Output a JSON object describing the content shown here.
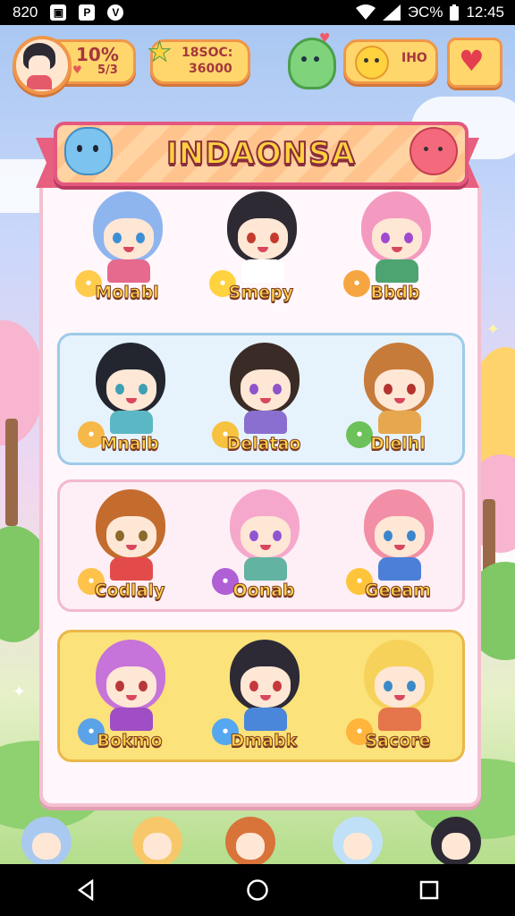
{
  "status_bar": {
    "left_text": "820",
    "icons": [
      "gallery-icon",
      "p-app-icon",
      "v-app-icon"
    ],
    "battery_text": "ЭС%",
    "time": "12:45"
  },
  "hud": {
    "level": "10%",
    "sub_value": "5/3",
    "star_value": "18SOC:",
    "star_sub": "36000",
    "coin_value": "IHO"
  },
  "banner": {
    "title": "INDAONSA"
  },
  "rows": [
    {
      "bg": "#ffffff",
      "border": "#f2d2dc",
      "characters": [
        {
          "name": "Molabl",
          "hair": "#8fb5ef",
          "eye": "#3d8fd3",
          "body": "#e56a8e",
          "pet": "#ffcb4a"
        },
        {
          "name": "Smepy",
          "hair": "#2d2a33",
          "eye": "#c43b2e",
          "body": "#ffffff",
          "pet": "#ffd23f"
        },
        {
          "name": "Bbdb",
          "hair": "#f49ac0",
          "eye": "#a04ad0",
          "body": "#4ea470",
          "pet": "#f6a640"
        }
      ]
    },
    {
      "bg": "#e6f3fc",
      "border": "#9dcbe9",
      "characters": [
        {
          "name": "Mnaib",
          "hair": "#23262f",
          "eye": "#3da0b4",
          "body": "#5bb7c3",
          "pet": "#f7b84a"
        },
        {
          "name": "Delatao",
          "hair": "#3b2b26",
          "eye": "#8f54c9",
          "body": "#8a6fd0",
          "pet": "#f6c23f"
        },
        {
          "name": "Dlelhl",
          "hair": "#c77b3a",
          "eye": "#b4332e",
          "body": "#e7a74f",
          "pet": "#6cc15a"
        }
      ]
    },
    {
      "bg": "#fdeff5",
      "border": "#f2b9cf",
      "characters": [
        {
          "name": "Codlaly",
          "hair": "#c46b2e",
          "eye": "#8b6a2a",
          "body": "#e34b4b",
          "pet": "#ffc24a"
        },
        {
          "name": "Oonab",
          "hair": "#f6a8cc",
          "eye": "#9155d2",
          "body": "#62b3a1",
          "pet": "#b05fd5"
        },
        {
          "name": "Geeam",
          "hair": "#f28ea6",
          "eye": "#3a86cc",
          "body": "#4b7fd8",
          "pet": "#ffc53a"
        }
      ]
    },
    {
      "bg": "#fbe27a",
      "border": "#eab84a",
      "characters": [
        {
          "name": "Bokmo",
          "hair": "#c673da",
          "eye": "#b7383b",
          "body": "#a04ec5",
          "pet": "#5aa3e8"
        },
        {
          "name": "Dmabk",
          "hair": "#2d2a36",
          "eye": "#c5393d",
          "body": "#4a86d9",
          "pet": "#55a7f0"
        },
        {
          "name": "Sacore",
          "hair": "#f6d25b",
          "eye": "#3b8ac7",
          "body": "#e5754a",
          "pet": "#ffb43b"
        }
      ]
    }
  ],
  "bottom_characters": [
    {
      "hair": "#a9c9f0"
    },
    {
      "hair": "#f7c86a"
    },
    {
      "hair": "#d8733a"
    },
    {
      "hair": "#bfe0f7"
    },
    {
      "hair": "#2d2a36"
    }
  ],
  "nav": {
    "back": "back-icon",
    "home": "home-icon",
    "recents": "recents-icon"
  }
}
